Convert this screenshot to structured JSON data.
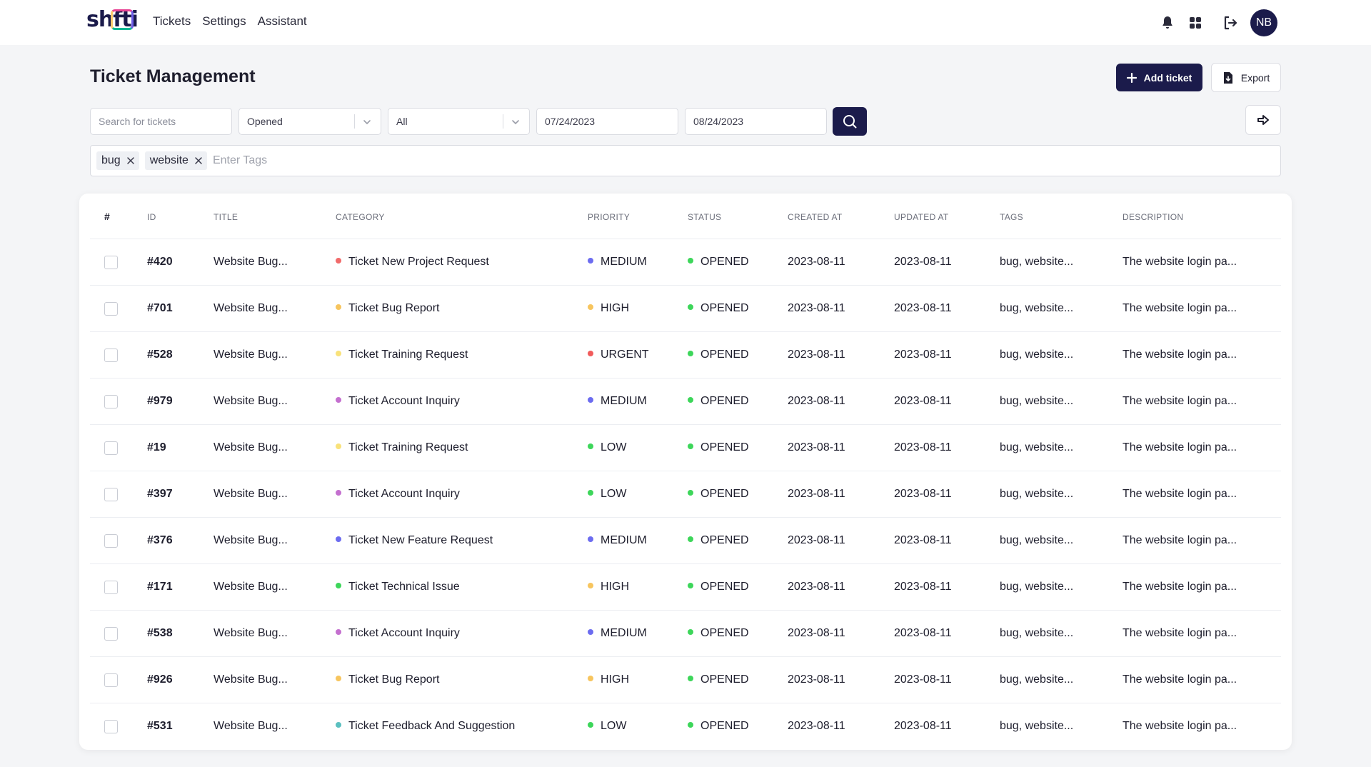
{
  "app": {
    "logo_text": "shifti",
    "nav": [
      "Tickets",
      "Settings",
      "Assistant"
    ],
    "user_initials": "NB"
  },
  "page": {
    "title": "Ticket Management",
    "add_label": "Add ticket",
    "export_label": "Export"
  },
  "filters": {
    "search_placeholder": "Search for tickets",
    "status_value": "Opened",
    "category_value": "All",
    "date_from": "07/24/2023",
    "date_to": "08/24/2023",
    "tags": [
      "bug",
      "website"
    ],
    "tags_placeholder": "Enter Tags"
  },
  "table": {
    "columns": [
      "#",
      "ID",
      "TITLE",
      "CATEGORY",
      "PRIORITY",
      "STATUS",
      "CREATED AT",
      "UPDATED AT",
      "TAGS",
      "DESCRIPTION"
    ],
    "rows": [
      {
        "id": "#420",
        "title": "Website Bug...",
        "category": "Ticket New Project Request",
        "category_color": "#f16a6a",
        "priority": "MEDIUM",
        "priority_color": "#6c6cf0",
        "status": "OPENED",
        "status_color": "#3dd65a",
        "created": "2023-08-11",
        "updated": "2023-08-11",
        "tags": "bug, website...",
        "description": "The website login pa..."
      },
      {
        "id": "#701",
        "title": "Website Bug...",
        "category": "Ticket Bug Report",
        "category_color": "#f7c55e",
        "priority": "HIGH",
        "priority_color": "#f7c55e",
        "status": "OPENED",
        "status_color": "#3dd65a",
        "created": "2023-08-11",
        "updated": "2023-08-11",
        "tags": "bug, website...",
        "description": "The website login pa..."
      },
      {
        "id": "#528",
        "title": "Website Bug...",
        "category": "Ticket Training Request",
        "category_color": "#f9e27a",
        "priority": "URGENT",
        "priority_color": "#f15b5b",
        "status": "OPENED",
        "status_color": "#3dd65a",
        "created": "2023-08-11",
        "updated": "2023-08-11",
        "tags": "bug, website...",
        "description": "The website login pa..."
      },
      {
        "id": "#979",
        "title": "Website Bug...",
        "category": "Ticket Account Inquiry",
        "category_color": "#c46fcf",
        "priority": "MEDIUM",
        "priority_color": "#6c6cf0",
        "status": "OPENED",
        "status_color": "#3dd65a",
        "created": "2023-08-11",
        "updated": "2023-08-11",
        "tags": "bug, website...",
        "description": "The website login pa..."
      },
      {
        "id": "#19",
        "title": "Website Bug...",
        "category": "Ticket Training Request",
        "category_color": "#f9e27a",
        "priority": "LOW",
        "priority_color": "#3dd65a",
        "status": "OPENED",
        "status_color": "#3dd65a",
        "created": "2023-08-11",
        "updated": "2023-08-11",
        "tags": "bug, website...",
        "description": "The website login pa..."
      },
      {
        "id": "#397",
        "title": "Website Bug...",
        "category": "Ticket Account Inquiry",
        "category_color": "#c46fcf",
        "priority": "LOW",
        "priority_color": "#3dd65a",
        "status": "OPENED",
        "status_color": "#3dd65a",
        "created": "2023-08-11",
        "updated": "2023-08-11",
        "tags": "bug, website...",
        "description": "The website login pa..."
      },
      {
        "id": "#376",
        "title": "Website Bug...",
        "category": "Ticket New Feature Request",
        "category_color": "#6c6cf0",
        "priority": "MEDIUM",
        "priority_color": "#6c6cf0",
        "status": "OPENED",
        "status_color": "#3dd65a",
        "created": "2023-08-11",
        "updated": "2023-08-11",
        "tags": "bug, website...",
        "description": "The website login pa..."
      },
      {
        "id": "#171",
        "title": "Website Bug...",
        "category": "Ticket Technical Issue",
        "category_color": "#3dd65a",
        "priority": "HIGH",
        "priority_color": "#f7c55e",
        "status": "OPENED",
        "status_color": "#3dd65a",
        "created": "2023-08-11",
        "updated": "2023-08-11",
        "tags": "bug, website...",
        "description": "The website login pa..."
      },
      {
        "id": "#538",
        "title": "Website Bug...",
        "category": "Ticket Account Inquiry",
        "category_color": "#c46fcf",
        "priority": "MEDIUM",
        "priority_color": "#6c6cf0",
        "status": "OPENED",
        "status_color": "#3dd65a",
        "created": "2023-08-11",
        "updated": "2023-08-11",
        "tags": "bug, website...",
        "description": "The website login pa..."
      },
      {
        "id": "#926",
        "title": "Website Bug...",
        "category": "Ticket Bug Report",
        "category_color": "#f7c55e",
        "priority": "HIGH",
        "priority_color": "#f7c55e",
        "status": "OPENED",
        "status_color": "#3dd65a",
        "created": "2023-08-11",
        "updated": "2023-08-11",
        "tags": "bug, website...",
        "description": "The website login pa..."
      },
      {
        "id": "#531",
        "title": "Website Bug...",
        "category": "Ticket Feedback And Suggestion",
        "category_color": "#5bc0c0",
        "priority": "LOW",
        "priority_color": "#3dd65a",
        "status": "OPENED",
        "status_color": "#3dd65a",
        "created": "2023-08-11",
        "updated": "2023-08-11",
        "tags": "bug, website...",
        "description": "The website login pa..."
      }
    ]
  },
  "icons": {
    "notifications": "bell-icon",
    "apps": "grid-icon",
    "logout": "logout-icon",
    "add": "plus-icon",
    "export": "file-export-icon",
    "search": "search-icon",
    "next": "arrow-right-icon",
    "remove_tag": "close-icon",
    "dropdown": "chevron-down-icon"
  }
}
